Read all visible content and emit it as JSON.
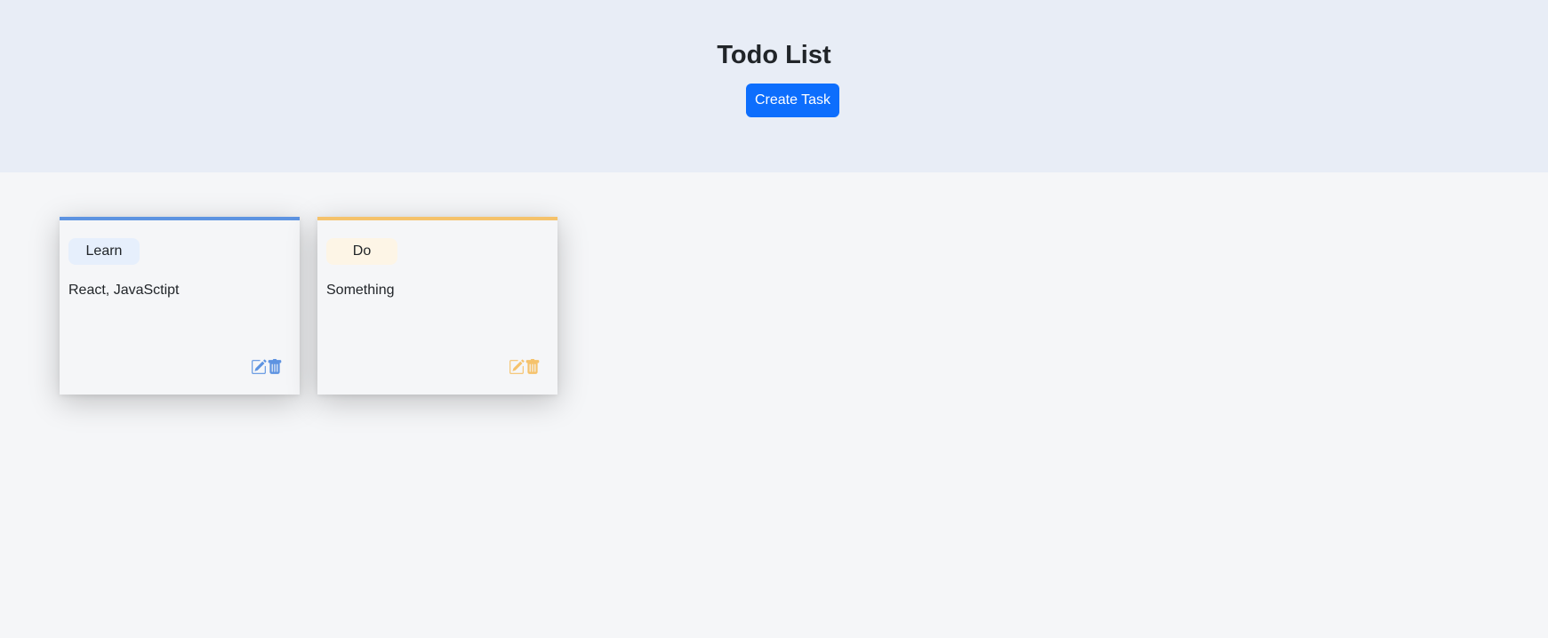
{
  "header": {
    "title": "Todo List",
    "create_button_label": "Create Task"
  },
  "tasks": [
    {
      "category": "Learn",
      "description": "React, JavaSctipt",
      "accent_color": "#5d93e1",
      "tag_bg": "#e6effc",
      "edit_icon": "edit-icon",
      "delete_icon": "trash-icon"
    },
    {
      "category": "Do",
      "description": "Something",
      "accent_color": "#f5c26b",
      "tag_bg": "#fdf5e6",
      "edit_icon": "edit-icon",
      "delete_icon": "trash-icon"
    }
  ],
  "colors": {
    "header_bg": "#e8edf6",
    "page_bg": "#f5f6f8",
    "primary": "#0d6efd"
  }
}
